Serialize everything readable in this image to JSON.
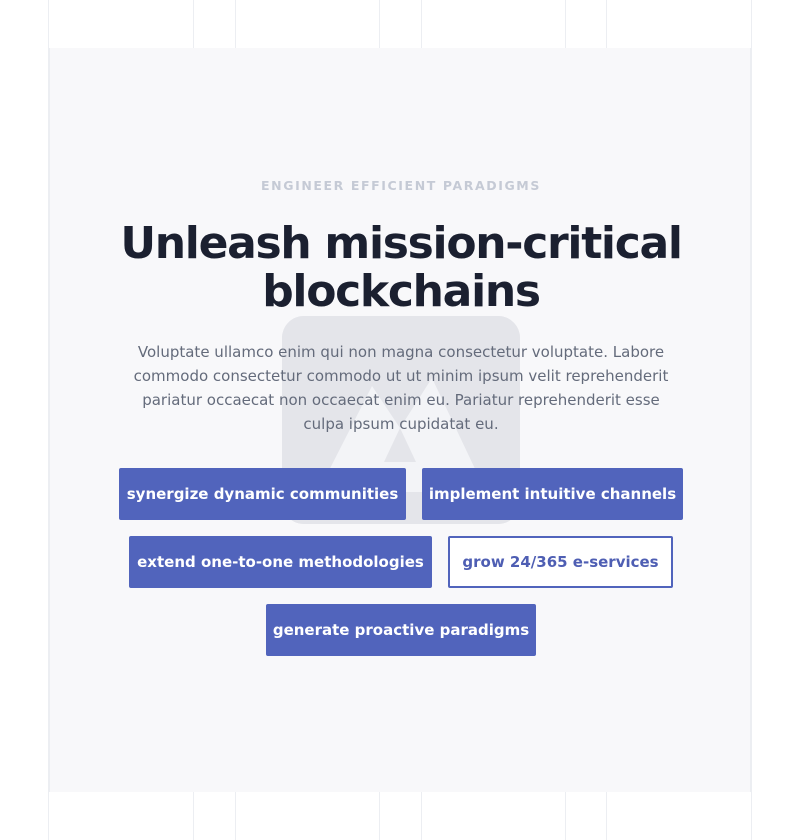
{
  "hero": {
    "eyebrow": "ENGINEER EFFICIENT PARADIGMS",
    "headline": "Unleash mission-critical blockchains",
    "lead": "Voluptate ullamco enim qui non magna consectetur voluptate. Labore commodo consectetur commodo ut ut minim ipsum velit reprehenderit pariatur occaecat non occaecat enim eu. Pariatur reprehenderit esse culpa ipsum cupidatat eu.",
    "image_icon": "mountain-placeholder-icon",
    "buttons": [
      {
        "label": "synergize dynamic communities",
        "style": "filled"
      },
      {
        "label": "implement intuitive channels",
        "style": "filled"
      },
      {
        "label": "extend one-to-one methodologies",
        "style": "filled"
      },
      {
        "label": "grow 24/365 e-services",
        "style": "outline"
      },
      {
        "label": "generate proactive paradigms",
        "style": "filled"
      }
    ]
  },
  "colors": {
    "accent": "#5164bc",
    "heading": "#1b2030",
    "body_text": "#646b7b",
    "eyebrow": "#c5cad5",
    "hero_background": "#f8f8fa"
  }
}
